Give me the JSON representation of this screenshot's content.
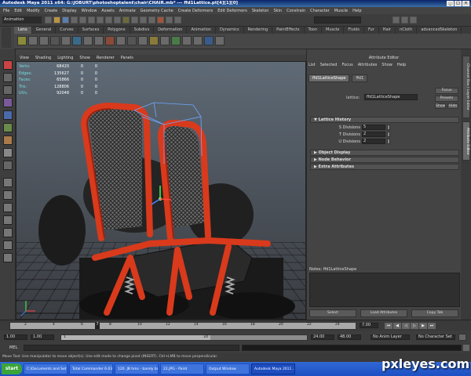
{
  "window": {
    "title": "Autodesk Maya 2011 x64: G:\\JOBURT\\photoshoptalent\\chair\\CHAIR.mb* --- ffd1Lattice.pt[4][1][0]"
  },
  "menubar": [
    "File",
    "Edit",
    "Modify",
    "Create",
    "Display",
    "Window",
    "Assets",
    "Animate",
    "Geometry Cache",
    "Create Deformers",
    "Edit Deformers",
    "Skeleton",
    "Skin",
    "Constrain",
    "Character",
    "Muscle",
    "Help"
  ],
  "statusline": {
    "mode": "Animation"
  },
  "shelf": {
    "tabs": [
      "Lens",
      "General",
      "Curves",
      "Surfaces",
      "Polygons",
      "Subdivs",
      "Deformation",
      "Animation",
      "Dynamics",
      "Rendering",
      "PaintEffects",
      "Toon",
      "Muscle",
      "Fluids",
      "Fur",
      "Hair",
      "nCloth",
      "advancedSkeleton"
    ],
    "active_tab": "Lens"
  },
  "viewport": {
    "menu": [
      "View",
      "Shading",
      "Lighting",
      "Show",
      "Renderer",
      "Panels"
    ],
    "hud": [
      {
        "label": "Verts:",
        "value": "68420",
        "sel": "0",
        "comp": "0"
      },
      {
        "label": "Edges:",
        "value": "135627",
        "sel": "0",
        "comp": "0"
      },
      {
        "label": "Faces:",
        "value": "65866",
        "sel": "0",
        "comp": "0"
      },
      {
        "label": "Tris:",
        "value": "128806",
        "sel": "0",
        "comp": "0"
      },
      {
        "label": "UVs:",
        "value": "92048",
        "sel": "0",
        "comp": "0"
      }
    ]
  },
  "attribute_editor": {
    "title": "Attribute Editor",
    "menu": [
      "List",
      "Selected",
      "Focus",
      "Attributes",
      "Show",
      "Help"
    ],
    "tabs": [
      "ffd1LatticeShape",
      "ffd1"
    ],
    "lattice_label": "lattice:",
    "lattice_value": "ffd1LatticeShape",
    "focus_label": "Focus",
    "presets_label": "Presets",
    "show_label": "Show",
    "hide_label": "Hide",
    "sections": {
      "lattice_history": "Lattice History",
      "object_display": "Object Display",
      "node_behavior": "Node Behavior",
      "extra_attributes": "Extra Attributes"
    },
    "divisions": [
      {
        "label": "S Divisions",
        "value": "5"
      },
      {
        "label": "T Divisions",
        "value": "2"
      },
      {
        "label": "U Divisions",
        "value": "2"
      }
    ],
    "notes_label": "Notes: ffd1LatticeShape",
    "buttons": [
      "Select",
      "Load Attributes",
      "Copy Tab"
    ],
    "side_tabs": [
      "Channel Box / Layer Editor",
      "Attribute Editor"
    ]
  },
  "timeslider": {
    "ticks": [
      "2",
      "4",
      "6",
      "8",
      "10",
      "12",
      "14",
      "16",
      "18",
      "20",
      "22",
      "24"
    ],
    "current_frame_field": "7.00",
    "current_frame_marker": "7"
  },
  "range": {
    "start": "1.00",
    "playback_start": "1.00",
    "handle_start": "1",
    "handle_end": "24",
    "playback_end": "24.00",
    "end": "48.00",
    "anim_layer": "No Anim Layer",
    "character_set": "No Character Set"
  },
  "commandline": {
    "label": "MEL"
  },
  "helpline": {
    "text": "Move Tool: Use manipulator to move object(s). Use edit mode to change pivot (INSERT). Ctrl+LMB to move perpendicular."
  },
  "taskbar": {
    "start": "start",
    "items": [
      "C:\\Documents and Set...",
      "Total Commander 6.03...",
      "120. JB hms - barely br...",
      "22.JPG - Paint",
      "Output Window",
      "Autodesk Maya 2011 ..."
    ],
    "active_index": 5
  },
  "watermark": "pxleyes.com",
  "colors": {
    "chair_frame": "#d93a1c",
    "maya_bg": "#444444",
    "lattice": "#6fa8ff",
    "taskbar": "#245edb"
  }
}
